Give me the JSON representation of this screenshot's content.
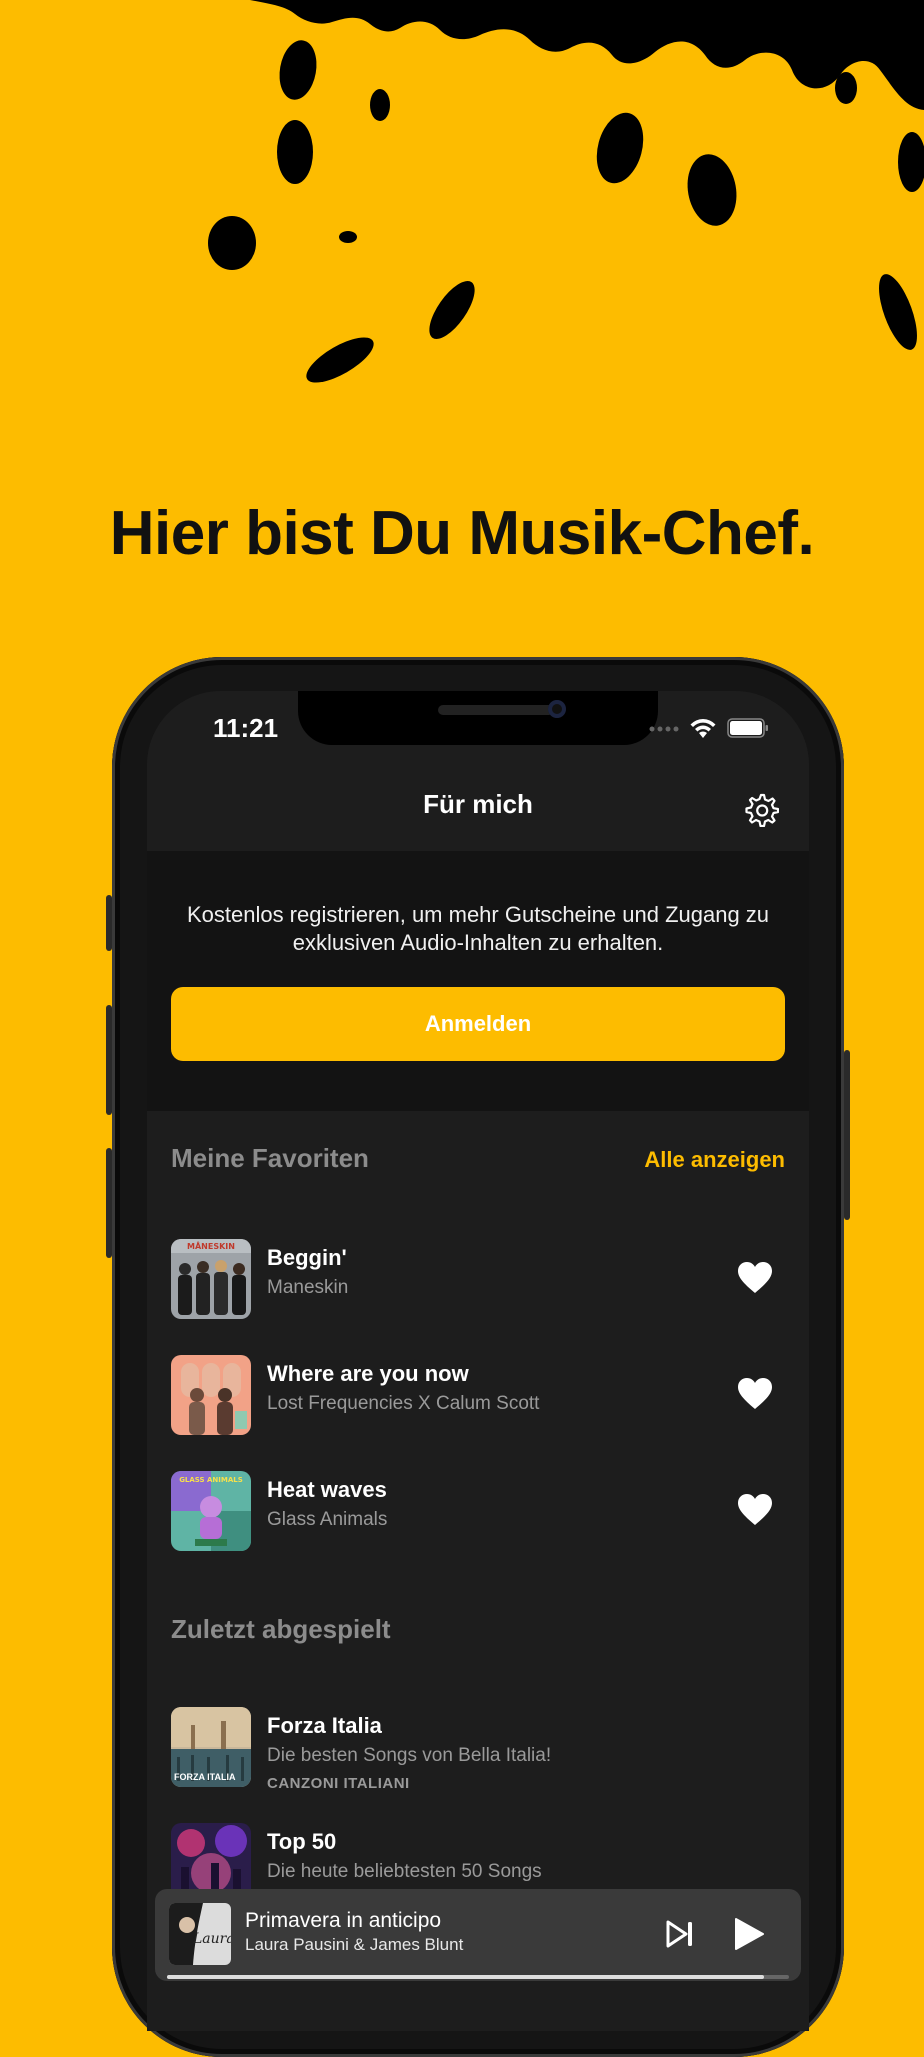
{
  "headline": "Hier bist Du Musik-Chef.",
  "status_bar": {
    "time": "11:21"
  },
  "nav": {
    "title": "Für mich"
  },
  "promo": {
    "text": "Kostenlos registrieren, um mehr Gutscheine und Zugang zu exklusiven Audio-Inhalten zu erhalten.",
    "button": "Anmelden"
  },
  "favorites": {
    "title": "Meine Favoriten",
    "see_all": "Alle anzeigen",
    "items": [
      {
        "title": "Beggin'",
        "artist": "Maneskin"
      },
      {
        "title": "Where are you now",
        "artist": "Lost Frequencies X Calum Scott"
      },
      {
        "title": "Heat waves",
        "artist": "Glass Animals"
      }
    ]
  },
  "recent": {
    "title": "Zuletzt abgespielt",
    "items": [
      {
        "title": "Forza Italia",
        "subtitle": "Die besten Songs von Bella Italia!",
        "category": "CANZONI ITALIANI",
        "cover_text": "FORZA ITALIA"
      },
      {
        "title": "Top 50",
        "subtitle": "Die heute beliebtesten 50 Songs"
      }
    ]
  },
  "player": {
    "title": "Primavera in anticipo",
    "artist": "Laura Pausini & James Blunt",
    "cover_text": "Laura",
    "progress": 0.96
  },
  "colors": {
    "accent": "#FDBC00",
    "background": "#1d1d1d"
  }
}
